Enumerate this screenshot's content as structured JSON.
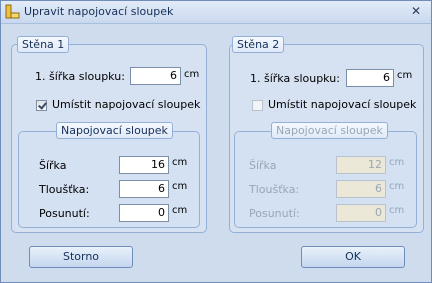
{
  "window": {
    "title": "Upravit napojovací sloupek",
    "close_glyph": "✕",
    "icon": "wall-column-icon"
  },
  "wall1": {
    "legend": "Stěna 1",
    "column_width_label": "1. šířka sloupku:",
    "column_width_value": "6",
    "column_width_unit": "cm",
    "place_checkbox_label": "Umístit napojovací sloupek",
    "place_checked": true,
    "inner": {
      "legend": "Napojovací sloupek",
      "width_label": "Šířka",
      "width_value": "16",
      "width_unit": "cm",
      "thickness_label": "Tloušťka:",
      "thickness_value": "6",
      "thickness_unit": "cm",
      "offset_label": "Posunutí:",
      "offset_value": "0",
      "offset_unit": "cm"
    }
  },
  "wall2": {
    "legend": "Stěna 2",
    "column_width_label": "1. šířka sloupku:",
    "column_width_value": "6",
    "column_width_unit": "cm",
    "place_checkbox_label": "Umístit napojovací sloupek",
    "place_checked": false,
    "inner": {
      "legend": "Napojovací sloupek",
      "width_label": "Šířka",
      "width_value": "12",
      "width_unit": "cm",
      "thickness_label": "Tloušťka:",
      "thickness_value": "6",
      "thickness_unit": "cm",
      "offset_label": "Posunutí:",
      "offset_value": "0",
      "offset_unit": "cm"
    }
  },
  "buttons": {
    "cancel": "Storno",
    "ok": "OK"
  }
}
